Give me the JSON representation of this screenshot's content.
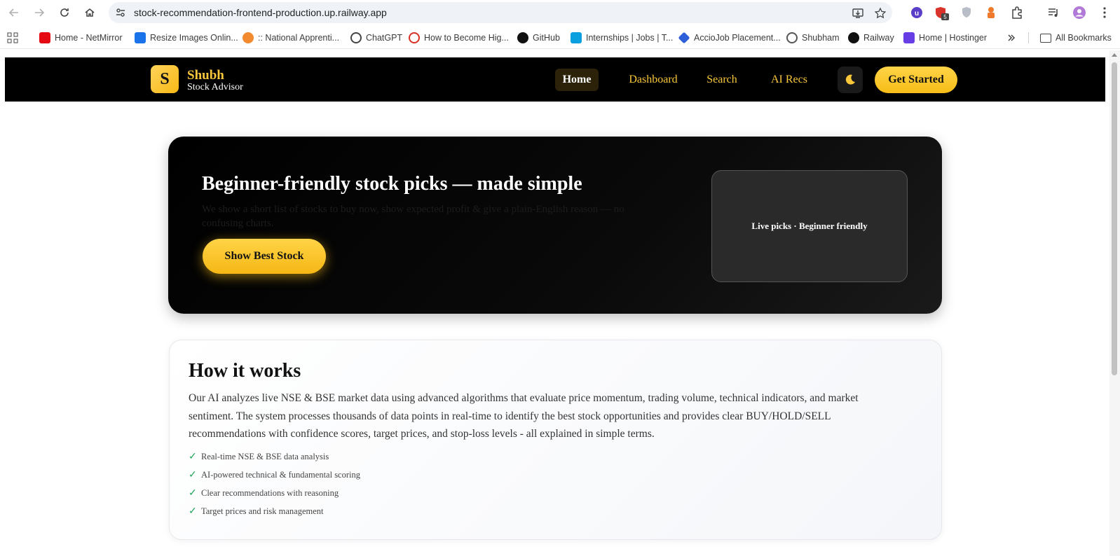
{
  "browser": {
    "url": "stock-recommendation-frontend-production.up.railway.app",
    "extension_badge": "5",
    "bookmarks": [
      {
        "label": "Home - NetMirror",
        "color": "#e50914"
      },
      {
        "label": "Resize Images Onlin...",
        "color": "#1a73e8"
      },
      {
        "label": ":: National Apprenti...",
        "color": "#f28b30"
      },
      {
        "label": "ChatGPT",
        "color": "#444444"
      },
      {
        "label": "How to Become Hig...",
        "color": "#d93025"
      },
      {
        "label": "GitHub",
        "color": "#111111"
      },
      {
        "label": "Internships | Jobs | T...",
        "color": "#0aa0e0"
      },
      {
        "label": "AccioJob Placement...",
        "color": "#2d5fd8"
      },
      {
        "label": "Shubham",
        "color": "#555555"
      },
      {
        "label": "Railway",
        "color": "#111111"
      },
      {
        "label": "Home | Hostinger",
        "color": "#673de6"
      }
    ],
    "all_bookmarks_label": "All Bookmarks"
  },
  "navbar": {
    "logo_letter": "S",
    "brand_name": "Shubh",
    "brand_sub": "Stock Advisor",
    "links": [
      "Home",
      "Dashboard",
      "Search",
      "AI Recs"
    ],
    "active_link": "Home",
    "cta_label": "Get Started",
    "accent_color": "#f8c73a"
  },
  "hero": {
    "title": "Beginner-friendly stock picks — made simple",
    "subtitle": "We show a short list of stocks to buy now, show expected profit & give a plain-English reason — no confusing charts.",
    "button_label": "Show Best Stock",
    "card_text": "Live picks · Beginner friendly"
  },
  "how_it_works": {
    "title": "How it works",
    "body": "Our AI analyzes live NSE & BSE market data using advanced algorithms that evaluate price momentum, trading volume, technical indicators, and market sentiment. The system processes thousands of data points in real-time to identify the best stock opportunities and provides clear BUY/HOLD/SELL recommendations with confidence scores, target prices, and stop-loss levels - all explained in simple terms.",
    "features": [
      "Real-time NSE & BSE data analysis",
      "AI-powered technical & fundamental scoring",
      "Clear recommendations with reasoning",
      "Target prices and risk management"
    ]
  }
}
